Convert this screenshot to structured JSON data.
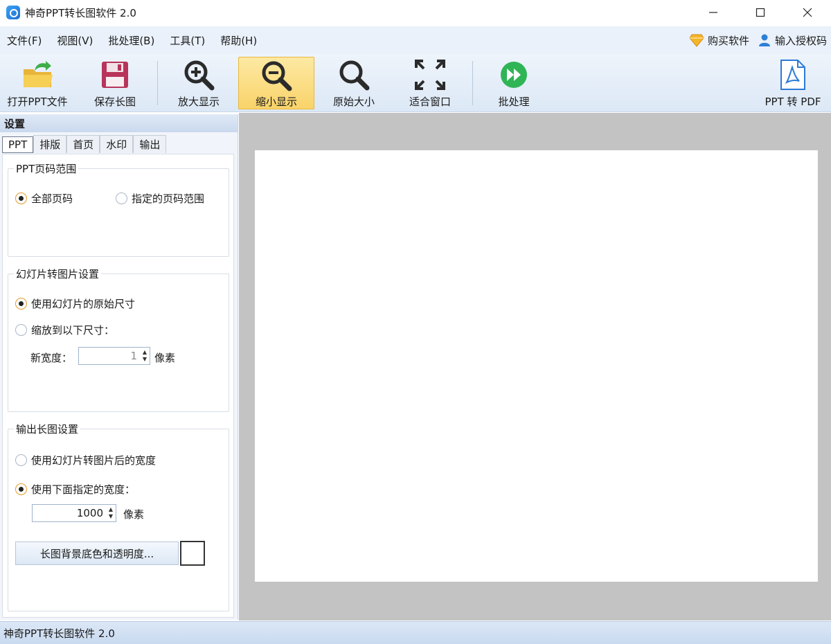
{
  "window": {
    "title": "神奇PPT转长图软件 2.0"
  },
  "menu": {
    "items": [
      "文件(F)",
      "视图(V)",
      "批处理(B)",
      "工具(T)",
      "帮助(H)"
    ],
    "buy": "购买软件",
    "license": "输入授权码"
  },
  "toolbar": {
    "open": "打开PPT文件",
    "save": "保存长图",
    "zoom_in": "放大显示",
    "zoom_out": "缩小显示",
    "original": "原始大小",
    "fit": "适合窗口",
    "batch": "批处理",
    "to_pdf": "PPT 转 PDF"
  },
  "panel": {
    "header": "设置",
    "tabs": [
      "PPT",
      "排版",
      "首页",
      "水印",
      "输出"
    ],
    "page_range": {
      "title": "PPT页码范围",
      "all": "全部页码",
      "specified": "指定的页码范围",
      "selected": "all"
    },
    "slide_image": {
      "title": "幻灯片转图片设置",
      "original": "使用幻灯片的原始尺寸",
      "scale": "缩放到以下尺寸：",
      "width_label": "新宽度：",
      "width_value": "1",
      "unit": "像素",
      "selected": "original"
    },
    "output": {
      "title": "输出长图设置",
      "slide_width": "使用幻灯片转图片后的宽度",
      "custom_width": "使用下面指定的宽度：",
      "width_value": "1000",
      "unit": "像素",
      "bg_button": "长图背景底色和透明度...",
      "bg_color": "#ffffff",
      "selected": "custom"
    }
  },
  "status": {
    "text": "神奇PPT转长图软件 2.0"
  },
  "colors": {
    "accent": "#e59a2a",
    "toolbar_active": "#f9d36a",
    "preview_bg": "#c3c3c3"
  }
}
